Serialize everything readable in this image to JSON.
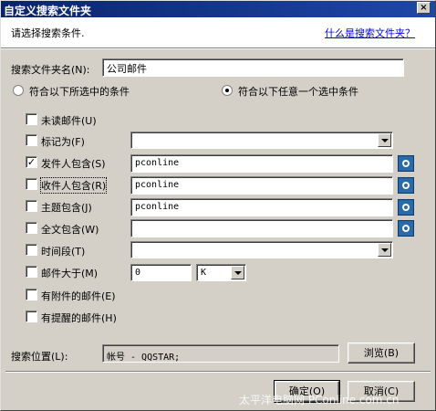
{
  "window": {
    "title": "自定义搜索文件夹",
    "close_label": "×"
  },
  "header": {
    "instruction": "请选择搜索条件.",
    "help_link": "什么是搜索文件夹？"
  },
  "folder_name": {
    "label": "搜索文件夹名(N):",
    "value": "公司邮件"
  },
  "match_mode": {
    "all_label": "符合以下所选中的条件",
    "any_label": "符合以下任意一个选中条件",
    "selected": "any"
  },
  "conditions": {
    "unread": {
      "label": "未读邮件(U)",
      "checked": false
    },
    "flagged": {
      "label": "标记为(F)",
      "checked": false,
      "value": ""
    },
    "sender": {
      "label": "发件人包含(S)",
      "checked": true,
      "value": "pconline"
    },
    "recipient": {
      "label": "收件人包含(R)",
      "checked": false,
      "value": "pconline"
    },
    "subject": {
      "label": "主题包含(J)",
      "checked": false,
      "value": "pconline"
    },
    "fulltext": {
      "label": "全文包含(W)",
      "checked": false,
      "value": ""
    },
    "time_range": {
      "label": "时间段(T)",
      "checked": false,
      "value": ""
    },
    "size": {
      "label": "邮件大于(M)",
      "checked": false,
      "value": "0",
      "unit": "K"
    },
    "attachment": {
      "label": "有附件的邮件(E)",
      "checked": false
    },
    "reminder": {
      "label": "有提醒的邮件(H)",
      "checked": false
    }
  },
  "location": {
    "label": "搜索位置(L):",
    "value": "帐号 - QQSTAR;",
    "browse_label": "浏览(B)"
  },
  "footer": {
    "ok_label": "确定(O)",
    "cancel_label": "取消(C)"
  },
  "watermark": "太平洋电脑网 PConline.com.cn",
  "icons": {
    "pick": "address-book-icon",
    "dropdown": "chevron-down-icon",
    "close": "close-icon"
  }
}
